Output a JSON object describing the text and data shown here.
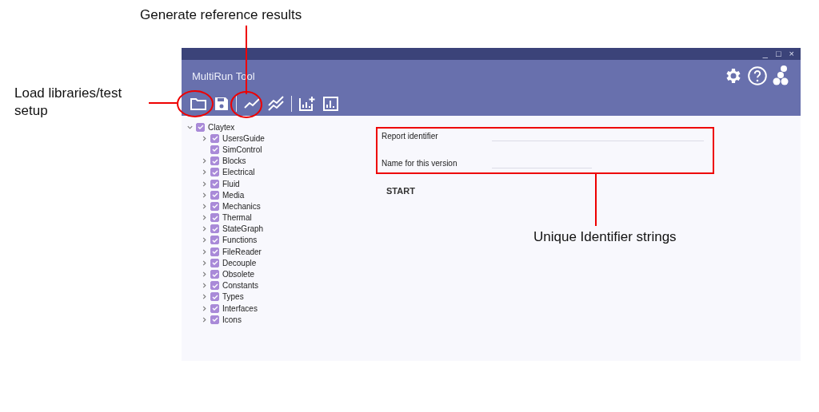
{
  "window": {
    "title": "MultiRun Tool",
    "controls": [
      "_",
      "□",
      "×"
    ]
  },
  "annotations": [
    {
      "kind": "top",
      "text": "Generate reference results"
    },
    {
      "kind": "left",
      "text": "Load libraries/test setup"
    },
    {
      "kind": "right",
      "text": "Unique Identifier strings"
    }
  ],
  "tree": {
    "label": "Claytex",
    "checked": true,
    "expanded": true,
    "children": [
      {
        "label": "UsersGuide",
        "checked": true,
        "kind": "folder"
      },
      {
        "label": "SimControl",
        "checked": true,
        "kind": "leaf"
      },
      {
        "label": "Blocks",
        "checked": true,
        "kind": "folder"
      },
      {
        "label": "Electrical",
        "checked": true,
        "kind": "folder"
      },
      {
        "label": "Fluid",
        "checked": true,
        "kind": "folder"
      },
      {
        "label": "Media",
        "checked": true,
        "kind": "folder"
      },
      {
        "label": "Mechanics",
        "checked": true,
        "kind": "folder"
      },
      {
        "label": "Thermal",
        "checked": true,
        "kind": "folder"
      },
      {
        "label": "StateGraph",
        "checked": true,
        "kind": "folder"
      },
      {
        "label": "Functions",
        "checked": true,
        "kind": "folder"
      },
      {
        "label": "FileReader",
        "checked": true,
        "kind": "folder"
      },
      {
        "label": "Decouple",
        "checked": true,
        "kind": "folder"
      },
      {
        "label": "Obsolete",
        "checked": true,
        "kind": "folder"
      },
      {
        "label": "Constants",
        "checked": true,
        "kind": "folder"
      },
      {
        "label": "Types",
        "checked": true,
        "kind": "folder"
      },
      {
        "label": "Interfaces",
        "checked": true,
        "kind": "folder"
      },
      {
        "label": "Icons",
        "checked": true,
        "kind": "folder"
      }
    ]
  },
  "fields": [
    {
      "label": "Report identifier",
      "kind": "long"
    },
    {
      "label": "Name for this version",
      "kind": "short"
    }
  ],
  "start_button": "START"
}
